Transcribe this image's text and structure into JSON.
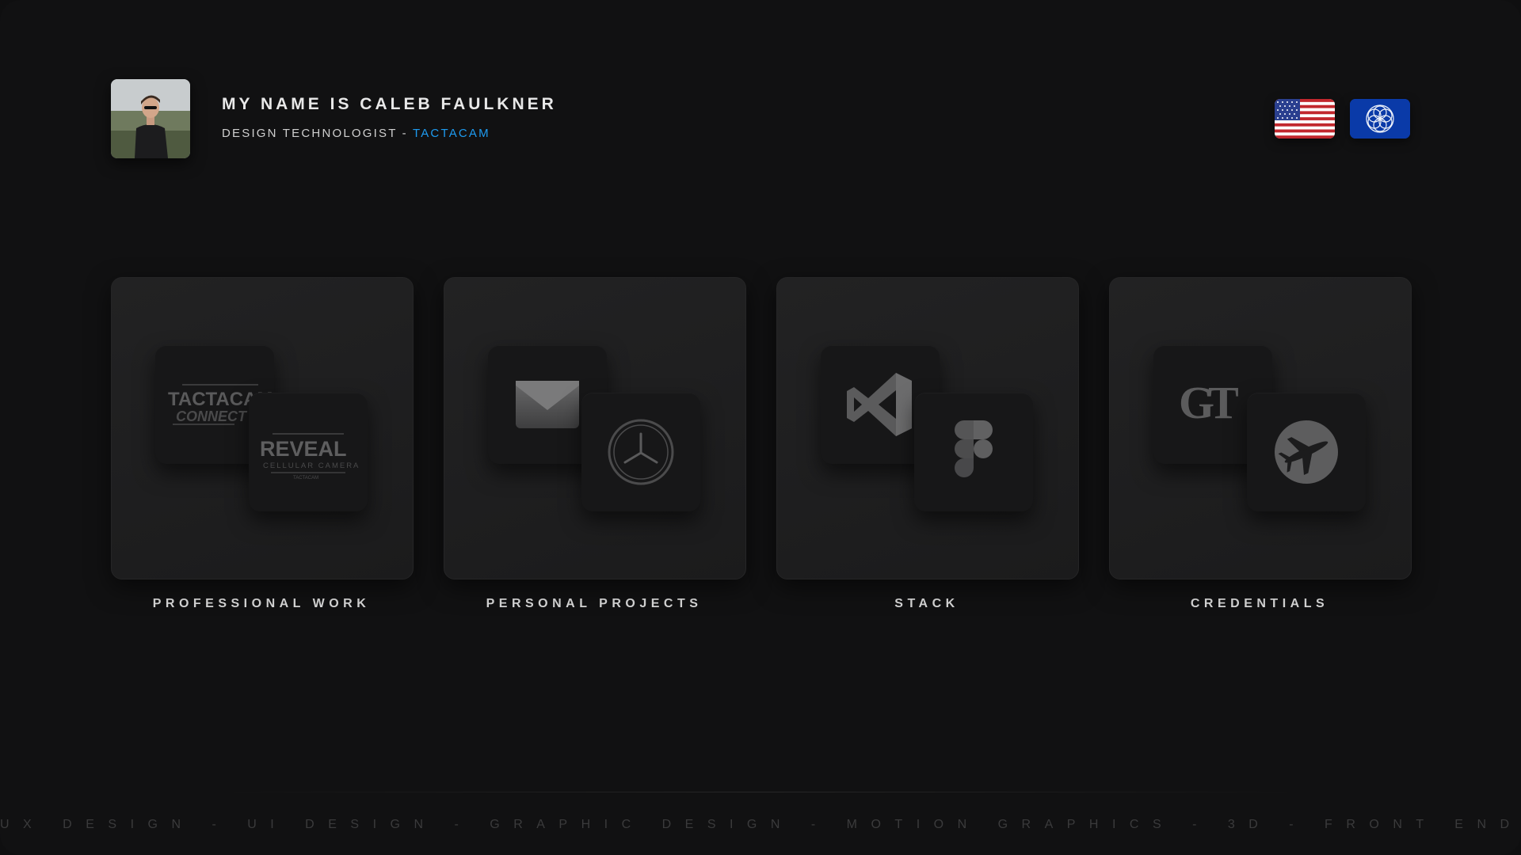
{
  "profile": {
    "name": "MY NAME IS CALEB FAULKNER",
    "role": "DESIGN TECHNOLOGIST - ",
    "company": "TACTACAM",
    "company_color": "#1e9bf0"
  },
  "language_switch": [
    {
      "icon": "us-flag-icon"
    },
    {
      "icon": "globe-flower-icon",
      "color": "#0a3aa8"
    }
  ],
  "cards": [
    {
      "label": "PROFESSIONAL WORK",
      "icons": [
        "tactacam-connect-logo",
        "reveal-cellular-camera-logo"
      ]
    },
    {
      "label": "PERSONAL PROJECTS",
      "icons": [
        "mail-icon",
        "compass-star-icon"
      ]
    },
    {
      "label": "STACK",
      "icons": [
        "vscode-icon",
        "figma-icon"
      ]
    },
    {
      "label": "CREDENTIALS",
      "icons": [
        "georgia-tech-logo",
        "airplane-badge-icon"
      ]
    }
  ],
  "logos": {
    "tactacam_line1": "TACTACAM",
    "tactacam_line2": "CONNECT",
    "reveal_line1": "REVEAL",
    "reveal_line2": "CELLULAR CAMERA",
    "reveal_line3": "TACTACAM",
    "gt": "GT"
  },
  "footer": {
    "skills": "UX DESIGN - UI DESIGN - GRAPHIC DESIGN - MOTION GRAPHICS - 3D - FRONT END"
  }
}
